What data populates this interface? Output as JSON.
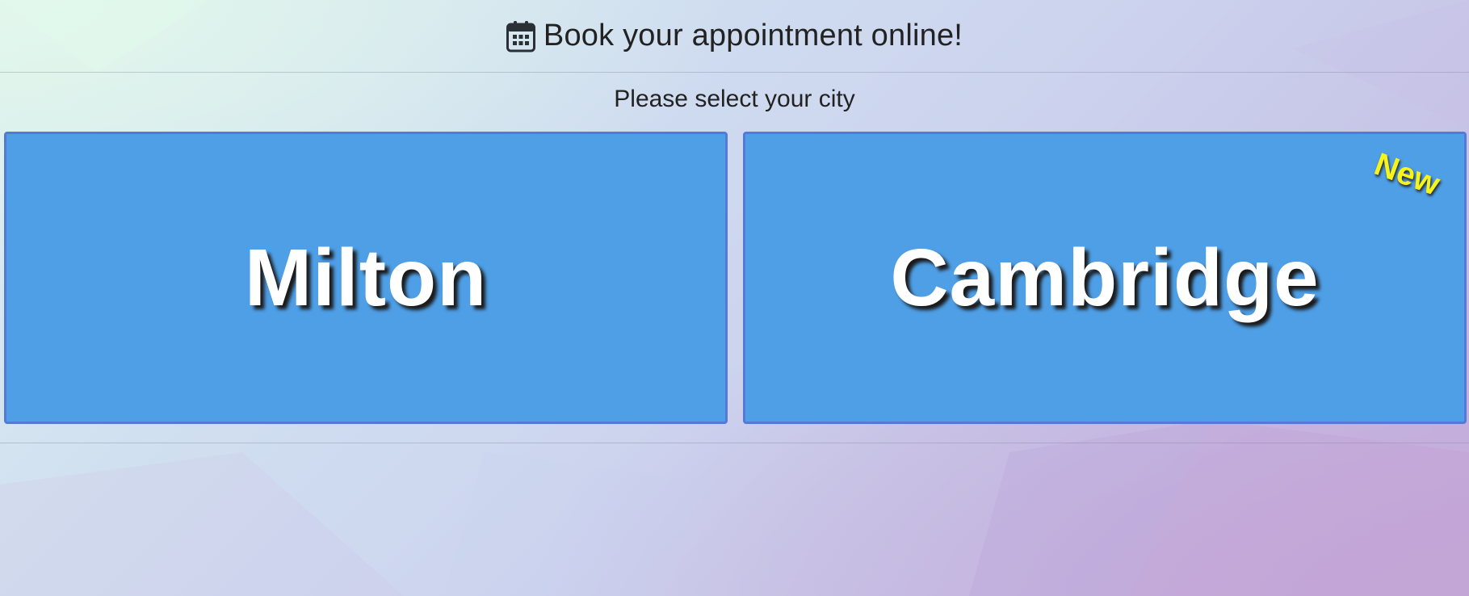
{
  "header": {
    "title": "Book your appointment online!",
    "icon": "calendar-icon"
  },
  "subtitle": "Please select your city",
  "cities": [
    {
      "name": "Milton",
      "badge": ""
    },
    {
      "name": "Cambridge",
      "badge": "New"
    }
  ],
  "colors": {
    "card_background": "#4f9fe6",
    "card_border": "#5579d6",
    "card_text": "#ffffff",
    "badge_text": "#f6f41a"
  }
}
